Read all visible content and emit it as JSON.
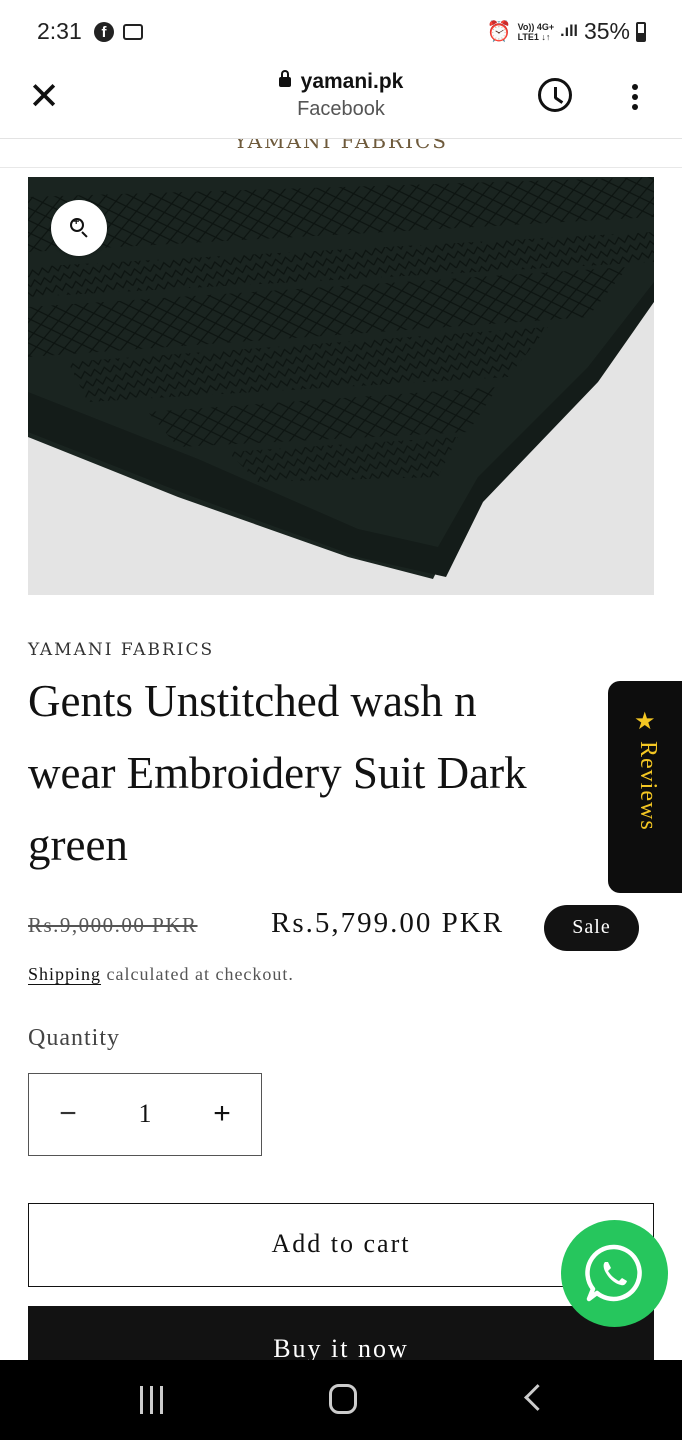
{
  "status_bar": {
    "time": "2:31",
    "battery": "35%",
    "network_top": "Vo)) 4G+",
    "network_bottom": "LTE1 ↓↑"
  },
  "browser": {
    "url": "yamani.pk",
    "subtitle": "Facebook"
  },
  "site": {
    "strip_text": "YAMANI FABRICS"
  },
  "product": {
    "vendor": "YAMANI FABRICS",
    "title_lines": [
      "Gents Unstitched wash n",
      "wear Embroidery Suit Dark",
      "green"
    ],
    "price_regular": "Rs.9,000.00 PKR",
    "price_sale": "Rs.5,799.00 PKR",
    "sale_badge": "Sale",
    "shipping_link": "Shipping",
    "shipping_rest": " calculated at checkout.",
    "quantity_label": "Quantity",
    "quantity_value": "1",
    "minus_symbol": "−",
    "plus_symbol": "+",
    "add_to_cart": "Add to cart",
    "buy_now": "Buy it now"
  },
  "reviews_tab": {
    "label": "Reviews",
    "star": "★"
  },
  "colors": {
    "fabric": "#1a2420",
    "accent_black": "#121212",
    "whatsapp_green": "#26c65d",
    "reviews_gold": "#f3c623"
  }
}
